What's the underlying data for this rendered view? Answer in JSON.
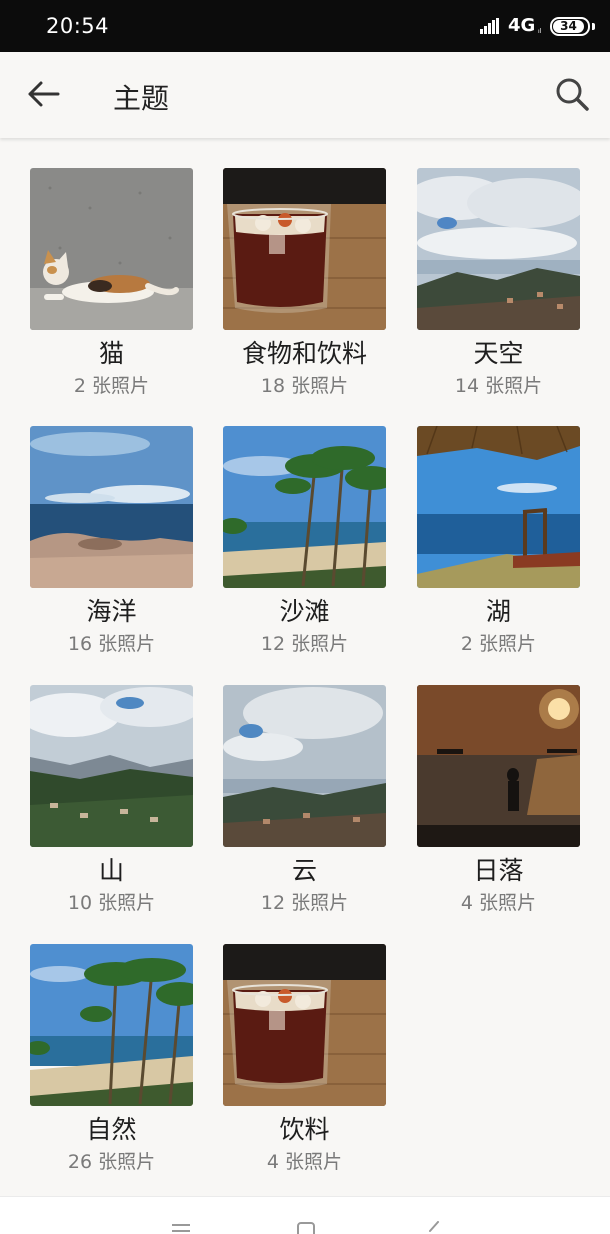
{
  "status_bar": {
    "time": "20:54",
    "network": "4G",
    "network_sub": "ıl",
    "battery": "34"
  },
  "header": {
    "title": "主题",
    "back_icon": "arrow-left-icon",
    "search_icon": "search-icon"
  },
  "albums": [
    {
      "title": "猫",
      "count": "2 张照片",
      "thumb": "cat"
    },
    {
      "title": "食物和饮料",
      "count": "18 张照片",
      "thumb": "drink"
    },
    {
      "title": "天空",
      "count": "14 张照片",
      "thumb": "sky"
    },
    {
      "title": "海洋",
      "count": "16 张照片",
      "thumb": "ocean"
    },
    {
      "title": "沙滩",
      "count": "12 张照片",
      "thumb": "beach"
    },
    {
      "title": "湖",
      "count": "2 张照片",
      "thumb": "lake"
    },
    {
      "title": "山",
      "count": "10 张照片",
      "thumb": "mountain"
    },
    {
      "title": "云",
      "count": "12 张照片",
      "thumb": "cloud"
    },
    {
      "title": "日落",
      "count": "4 张照片",
      "thumb": "sunset"
    },
    {
      "title": "自然",
      "count": "26 张照片",
      "thumb": "nature"
    },
    {
      "title": "饮料",
      "count": "4 张照片",
      "thumb": "drink2"
    }
  ],
  "nav_bar": {
    "menu_icon": "menu-icon",
    "home_icon": "home-square-icon",
    "back_icon": "back-chevron-icon"
  },
  "colors": {
    "background": "#f8f7f5",
    "status_bar": "#0c0c0c",
    "title_text": "#1e1e1e",
    "count_text": "#7a7a7a"
  }
}
